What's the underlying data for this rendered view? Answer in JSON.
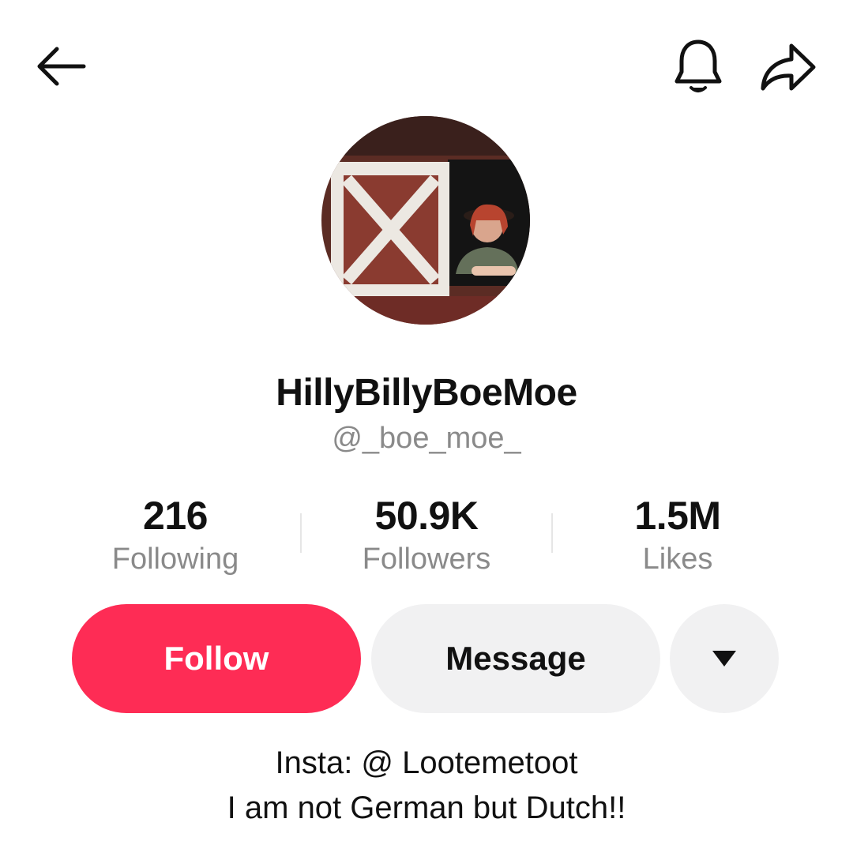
{
  "header": {
    "back_icon": "arrow-left-icon",
    "notification_icon": "bell-icon",
    "share_icon": "share-arrow-icon"
  },
  "profile": {
    "display_name": "HillyBillyBoeMoe",
    "username": "@_boe_moe_"
  },
  "stats": [
    {
      "value": "216",
      "label": "Following"
    },
    {
      "value": "50.9K",
      "label": "Followers"
    },
    {
      "value": "1.5M",
      "label": "Likes"
    }
  ],
  "actions": {
    "follow_label": "Follow",
    "message_label": "Message",
    "more_icon": "caret-down-icon"
  },
  "bio": {
    "line1": "Insta: @ Lootemetoot",
    "line2": "I am not German but Dutch!!"
  },
  "colors": {
    "follow_bg": "#fe2c55",
    "secondary_bg": "#f1f1f2",
    "muted_text": "#8a8a8a"
  }
}
